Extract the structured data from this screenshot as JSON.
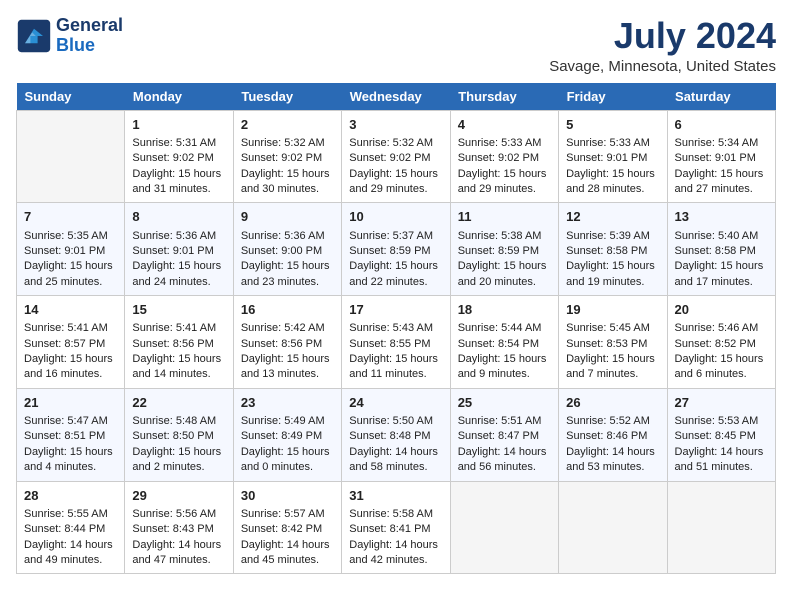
{
  "header": {
    "logo_line1": "General",
    "logo_line2": "Blue",
    "month": "July 2024",
    "location": "Savage, Minnesota, United States"
  },
  "weekdays": [
    "Sunday",
    "Monday",
    "Tuesday",
    "Wednesday",
    "Thursday",
    "Friday",
    "Saturday"
  ],
  "weeks": [
    [
      {
        "day": "",
        "empty": true
      },
      {
        "day": "1",
        "sunrise": "5:31 AM",
        "sunset": "9:02 PM",
        "daylight": "15 hours and 31 minutes."
      },
      {
        "day": "2",
        "sunrise": "5:32 AM",
        "sunset": "9:02 PM",
        "daylight": "15 hours and 30 minutes."
      },
      {
        "day": "3",
        "sunrise": "5:32 AM",
        "sunset": "9:02 PM",
        "daylight": "15 hours and 29 minutes."
      },
      {
        "day": "4",
        "sunrise": "5:33 AM",
        "sunset": "9:02 PM",
        "daylight": "15 hours and 29 minutes."
      },
      {
        "day": "5",
        "sunrise": "5:33 AM",
        "sunset": "9:01 PM",
        "daylight": "15 hours and 28 minutes."
      },
      {
        "day": "6",
        "sunrise": "5:34 AM",
        "sunset": "9:01 PM",
        "daylight": "15 hours and 27 minutes."
      }
    ],
    [
      {
        "day": "7",
        "sunrise": "5:35 AM",
        "sunset": "9:01 PM",
        "daylight": "15 hours and 25 minutes."
      },
      {
        "day": "8",
        "sunrise": "5:36 AM",
        "sunset": "9:01 PM",
        "daylight": "15 hours and 24 minutes."
      },
      {
        "day": "9",
        "sunrise": "5:36 AM",
        "sunset": "9:00 PM",
        "daylight": "15 hours and 23 minutes."
      },
      {
        "day": "10",
        "sunrise": "5:37 AM",
        "sunset": "8:59 PM",
        "daylight": "15 hours and 22 minutes."
      },
      {
        "day": "11",
        "sunrise": "5:38 AM",
        "sunset": "8:59 PM",
        "daylight": "15 hours and 20 minutes."
      },
      {
        "day": "12",
        "sunrise": "5:39 AM",
        "sunset": "8:58 PM",
        "daylight": "15 hours and 19 minutes."
      },
      {
        "day": "13",
        "sunrise": "5:40 AM",
        "sunset": "8:58 PM",
        "daylight": "15 hours and 17 minutes."
      }
    ],
    [
      {
        "day": "14",
        "sunrise": "5:41 AM",
        "sunset": "8:57 PM",
        "daylight": "15 hours and 16 minutes."
      },
      {
        "day": "15",
        "sunrise": "5:41 AM",
        "sunset": "8:56 PM",
        "daylight": "15 hours and 14 minutes."
      },
      {
        "day": "16",
        "sunrise": "5:42 AM",
        "sunset": "8:56 PM",
        "daylight": "15 hours and 13 minutes."
      },
      {
        "day": "17",
        "sunrise": "5:43 AM",
        "sunset": "8:55 PM",
        "daylight": "15 hours and 11 minutes."
      },
      {
        "day": "18",
        "sunrise": "5:44 AM",
        "sunset": "8:54 PM",
        "daylight": "15 hours and 9 minutes."
      },
      {
        "day": "19",
        "sunrise": "5:45 AM",
        "sunset": "8:53 PM",
        "daylight": "15 hours and 7 minutes."
      },
      {
        "day": "20",
        "sunrise": "5:46 AM",
        "sunset": "8:52 PM",
        "daylight": "15 hours and 6 minutes."
      }
    ],
    [
      {
        "day": "21",
        "sunrise": "5:47 AM",
        "sunset": "8:51 PM",
        "daylight": "15 hours and 4 minutes."
      },
      {
        "day": "22",
        "sunrise": "5:48 AM",
        "sunset": "8:50 PM",
        "daylight": "15 hours and 2 minutes."
      },
      {
        "day": "23",
        "sunrise": "5:49 AM",
        "sunset": "8:49 PM",
        "daylight": "15 hours and 0 minutes."
      },
      {
        "day": "24",
        "sunrise": "5:50 AM",
        "sunset": "8:48 PM",
        "daylight": "14 hours and 58 minutes."
      },
      {
        "day": "25",
        "sunrise": "5:51 AM",
        "sunset": "8:47 PM",
        "daylight": "14 hours and 56 minutes."
      },
      {
        "day": "26",
        "sunrise": "5:52 AM",
        "sunset": "8:46 PM",
        "daylight": "14 hours and 53 minutes."
      },
      {
        "day": "27",
        "sunrise": "5:53 AM",
        "sunset": "8:45 PM",
        "daylight": "14 hours and 51 minutes."
      }
    ],
    [
      {
        "day": "28",
        "sunrise": "5:55 AM",
        "sunset": "8:44 PM",
        "daylight": "14 hours and 49 minutes."
      },
      {
        "day": "29",
        "sunrise": "5:56 AM",
        "sunset": "8:43 PM",
        "daylight": "14 hours and 47 minutes."
      },
      {
        "day": "30",
        "sunrise": "5:57 AM",
        "sunset": "8:42 PM",
        "daylight": "14 hours and 45 minutes."
      },
      {
        "day": "31",
        "sunrise": "5:58 AM",
        "sunset": "8:41 PM",
        "daylight": "14 hours and 42 minutes."
      },
      {
        "day": "",
        "empty": true
      },
      {
        "day": "",
        "empty": true
      },
      {
        "day": "",
        "empty": true
      }
    ]
  ]
}
